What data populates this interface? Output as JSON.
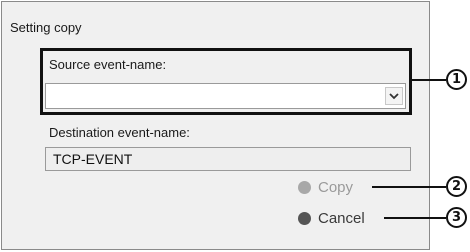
{
  "dialog": {
    "title": "Setting copy",
    "source_label": "Source event-name:",
    "source_value": "",
    "destination_label": "Destination event-name:",
    "destination_value": "TCP-EVENT",
    "copy_label": "Copy",
    "cancel_label": "Cancel"
  },
  "callouts": [
    "1",
    "2",
    "3"
  ],
  "icons": {
    "dropdown": "chevron-down-icon"
  }
}
